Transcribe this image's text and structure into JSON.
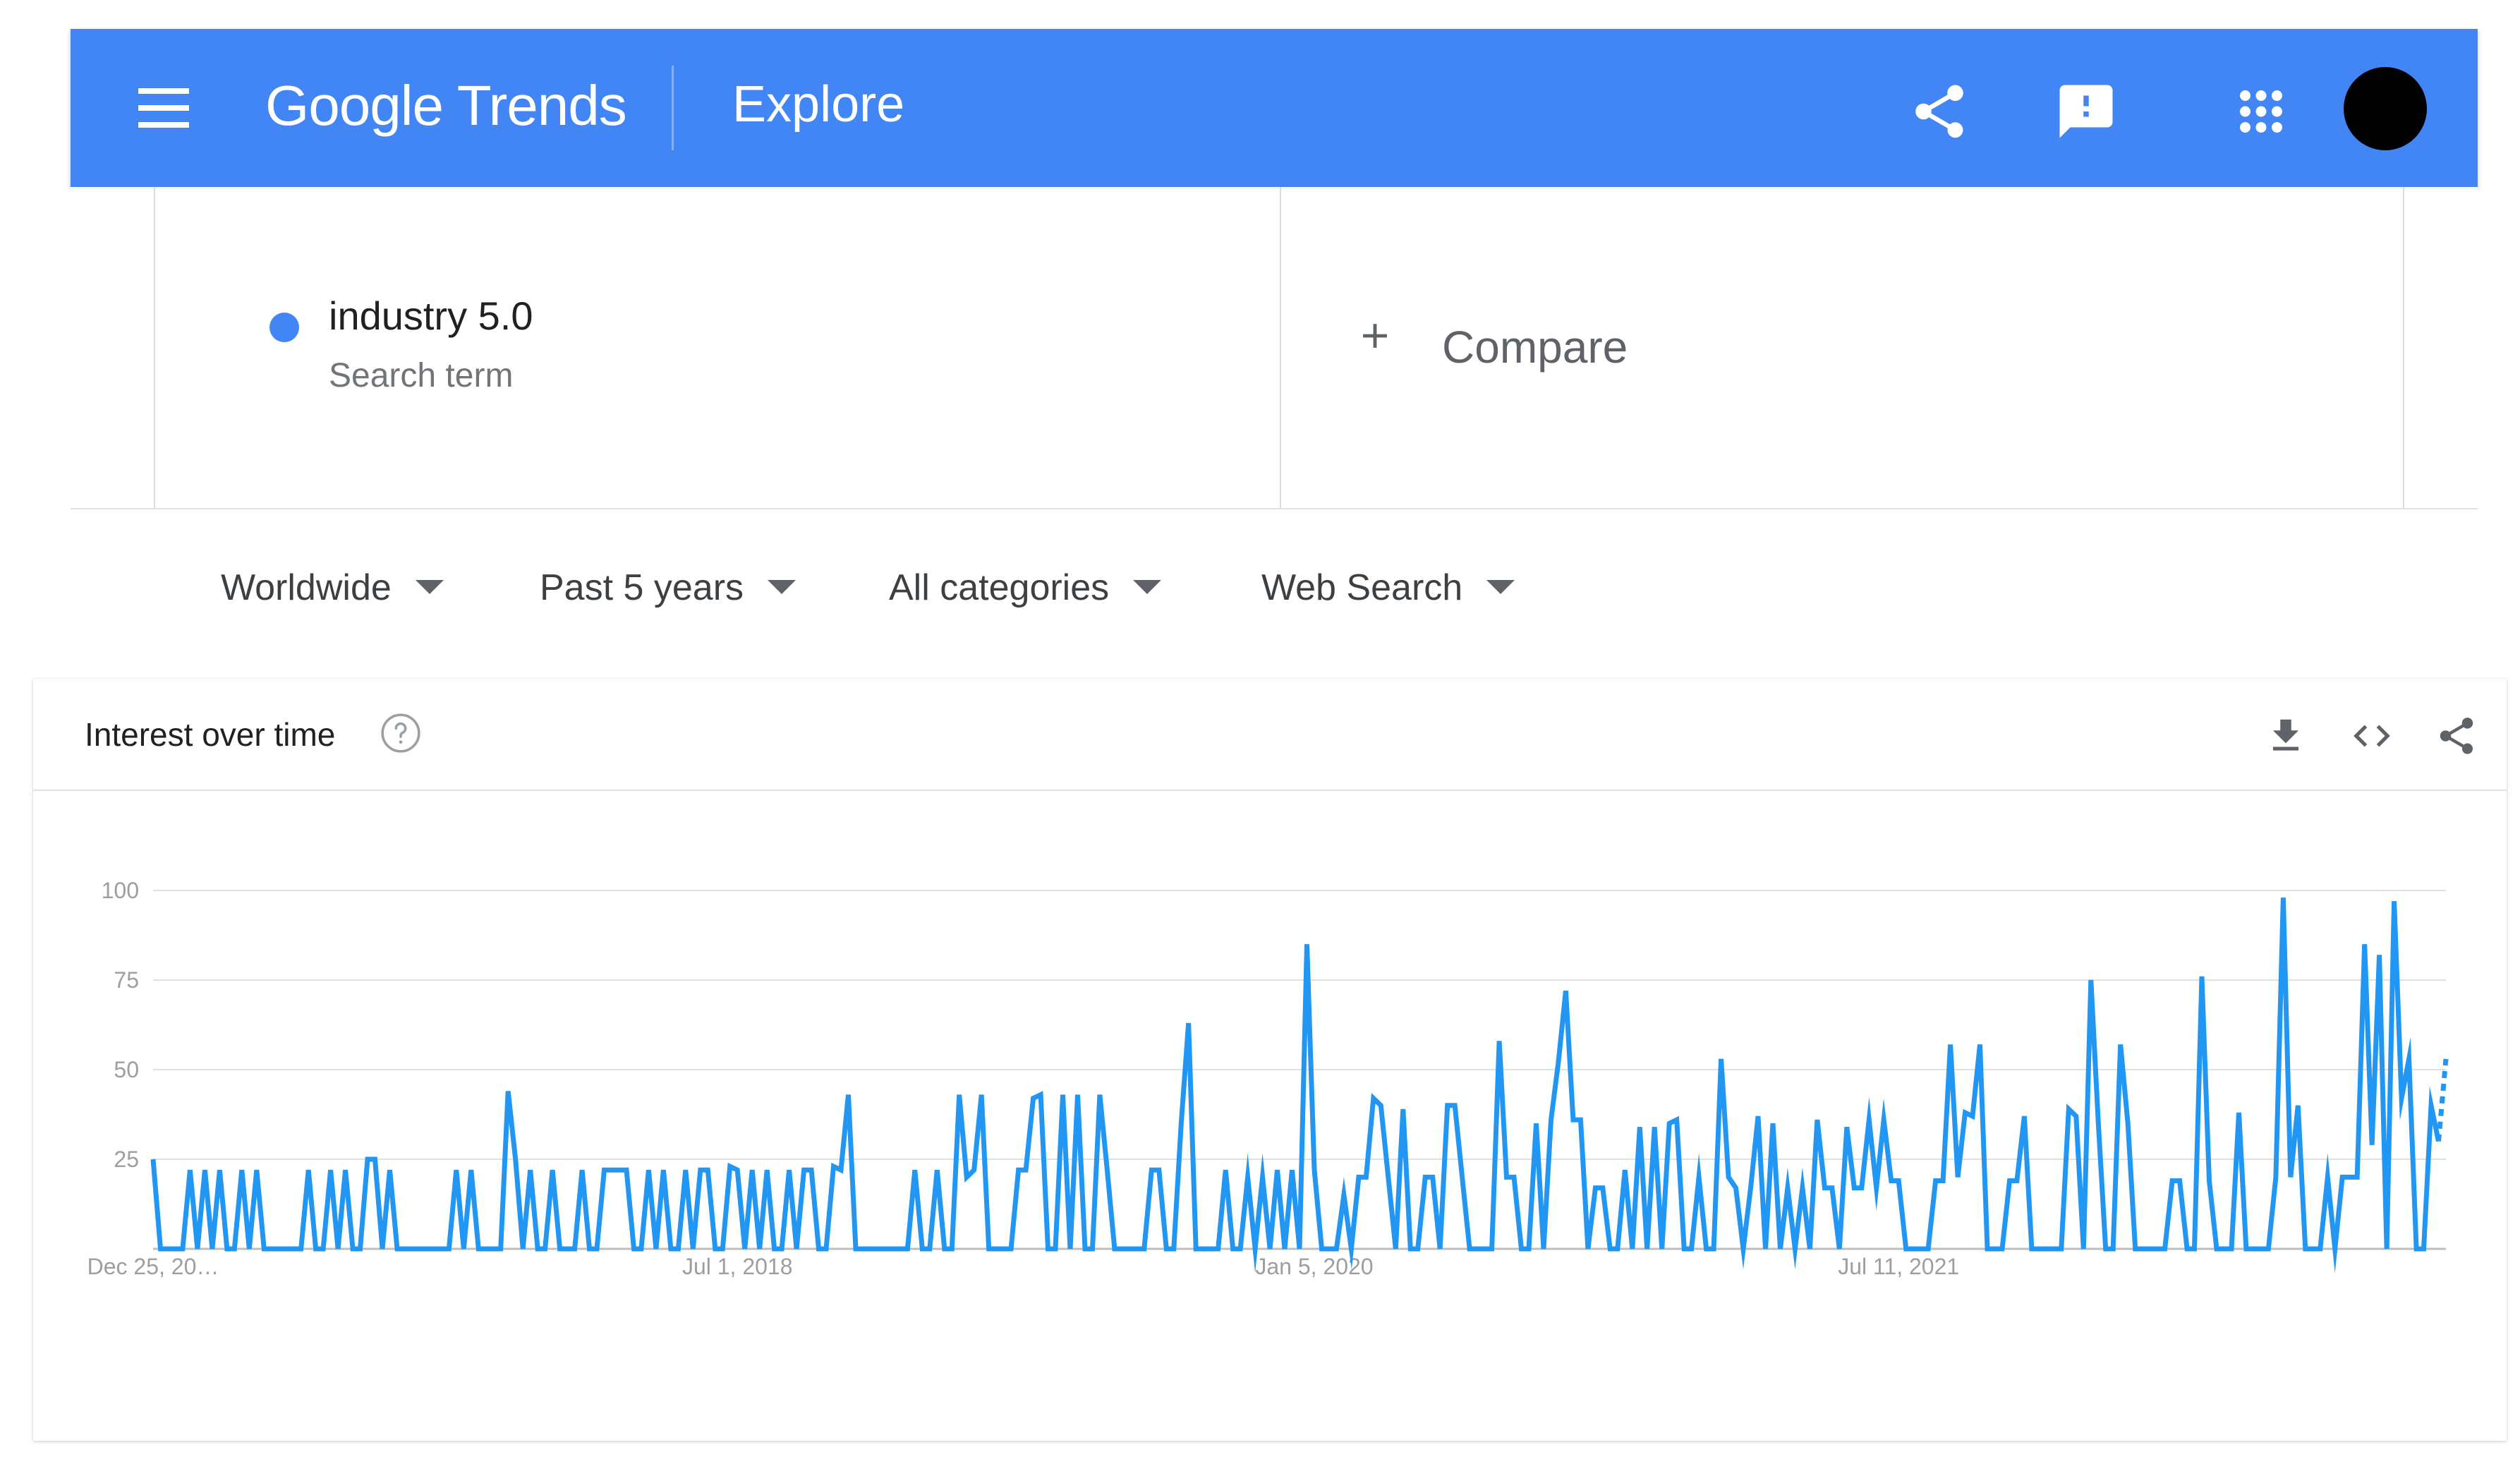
{
  "appbar": {
    "menu_icon": "menu-icon",
    "logo_text": "Google Trends",
    "page_title": "Explore",
    "actions": [
      "share-icon",
      "feedback-icon",
      "apps-icon"
    ],
    "avatar": "account-avatar",
    "background_color": "#4285f4"
  },
  "search_term": {
    "name": "industry 5.0",
    "subtitle": "Search term",
    "color": "#4285f4"
  },
  "compare": {
    "icon": "plus-icon",
    "label": "Compare"
  },
  "filters": {
    "region": "Worldwide",
    "time_range": "Past 5 years",
    "category": "All categories",
    "search_type": "Web Search"
  },
  "card": {
    "title": "Interest over time",
    "help_icon": "help-icon",
    "actions": [
      "download-icon",
      "embed-icon",
      "share-icon"
    ]
  },
  "chart_data": {
    "type": "line",
    "title": "Interest over time",
    "xlabel": "",
    "ylabel": "",
    "ylim": [
      0,
      100
    ],
    "yticks": [
      25,
      50,
      75,
      100
    ],
    "xtick_labels": [
      "Dec 25, 20…",
      "Jul 1, 2018",
      "Jan 5, 2020",
      "Jul 11, 2021"
    ],
    "xtick_index": [
      0,
      79,
      157,
      236
    ],
    "grid": true,
    "line_color": "#2196f3",
    "partial_last_point": true,
    "series": [
      {
        "values": [
          25,
          0,
          0,
          0,
          0,
          22,
          0,
          22,
          0,
          22,
          0,
          0,
          22,
          0,
          22,
          0,
          0,
          0,
          0,
          0,
          0,
          22,
          0,
          0,
          22,
          0,
          22,
          0,
          0,
          25,
          25,
          0,
          22,
          0,
          0,
          0,
          0,
          0,
          0,
          0,
          0,
          22,
          0,
          22,
          0,
          0,
          0,
          0,
          44,
          25,
          0,
          22,
          0,
          0,
          22,
          0,
          0,
          0,
          22,
          0,
          0,
          22,
          22,
          22,
          22,
          0,
          0,
          22,
          0,
          22,
          0,
          0,
          22,
          0,
          22,
          22,
          0,
          0,
          23,
          22,
          0,
          22,
          0,
          22,
          0,
          0,
          22,
          0,
          22,
          22,
          0,
          0,
          23,
          22,
          43,
          0,
          0,
          0,
          0,
          0,
          0,
          0,
          0,
          22,
          0,
          0,
          22,
          0,
          0,
          43,
          20,
          22,
          43,
          0,
          0,
          0,
          0,
          22,
          22,
          42,
          43,
          0,
          0,
          43,
          0,
          43,
          0,
          0,
          43,
          22,
          0,
          0,
          0,
          0,
          0,
          22,
          22,
          0,
          0,
          35,
          63,
          0,
          0,
          0,
          0,
          22,
          0,
          0,
          20,
          0,
          20,
          0,
          22,
          0,
          22,
          0,
          85,
          22,
          0,
          0,
          0,
          15,
          0,
          20,
          20,
          42,
          40,
          20,
          0,
          39,
          0,
          0,
          20,
          20,
          0,
          40,
          40,
          20,
          0,
          0,
          0,
          0,
          58,
          20,
          20,
          0,
          0,
          35,
          0,
          36,
          52,
          72,
          36,
          36,
          0,
          17,
          17,
          0,
          0,
          22,
          0,
          34,
          0,
          34,
          0,
          35,
          36,
          0,
          0,
          20,
          0,
          0,
          53,
          20,
          17,
          0,
          17,
          37,
          0,
          35,
          0,
          17,
          0,
          17,
          0,
          36,
          17,
          17,
          0,
          34,
          17,
          17,
          36,
          17,
          36,
          19,
          19,
          0,
          0,
          0,
          0,
          19,
          19,
          57,
          20,
          38,
          37,
          57,
          0,
          0,
          0,
          19,
          19,
          37,
          0,
          0,
          0,
          0,
          0,
          39,
          37,
          0,
          75,
          35,
          0,
          0,
          57,
          35,
          0,
          0,
          0,
          0,
          0,
          19,
          19,
          0,
          0,
          76,
          19,
          0,
          0,
          0,
          38,
          0,
          0,
          0,
          0,
          20,
          98,
          20,
          40,
          0,
          0,
          0,
          20,
          0,
          20,
          20,
          20,
          85,
          29,
          82,
          0,
          97,
          42,
          53,
          0,
          0,
          40,
          30,
          53
        ]
      }
    ]
  }
}
